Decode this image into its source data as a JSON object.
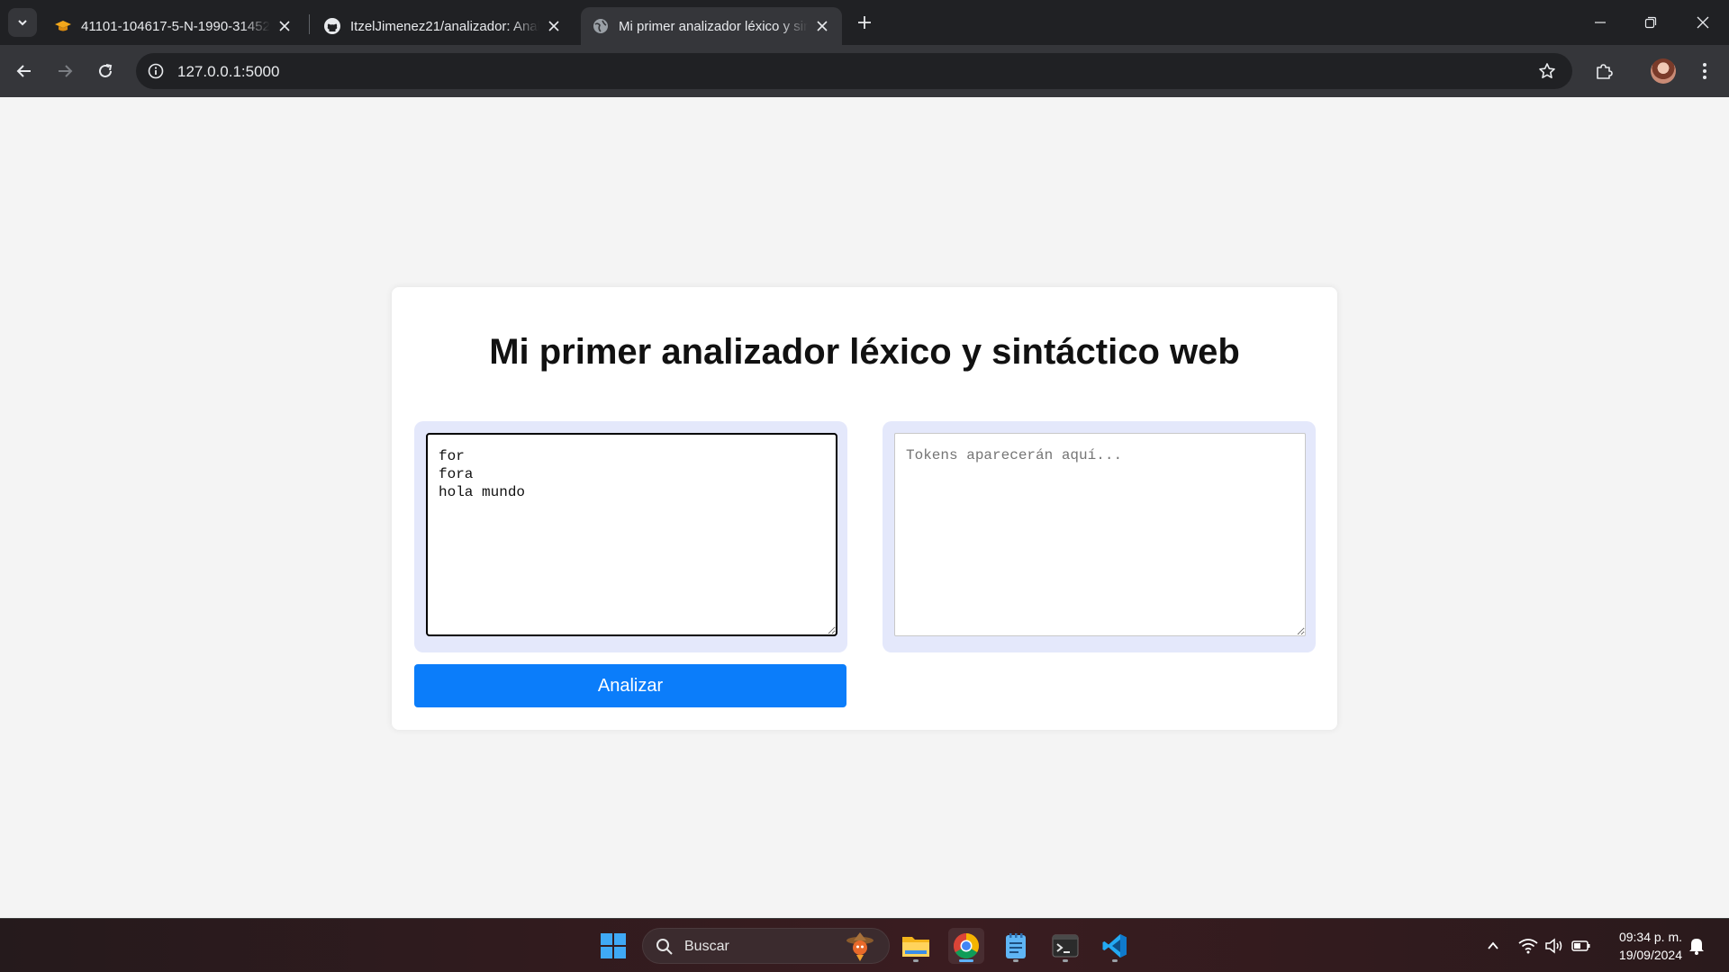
{
  "browser": {
    "tabs": [
      {
        "title": "41101-104617-5-N-1990-31452",
        "icon": "graduation-cap-icon",
        "active": false
      },
      {
        "title": "ItzelJimenez21/analizador: Anal",
        "icon": "github-icon",
        "active": false
      },
      {
        "title": "Mi primer analizador léxico y sin",
        "icon": "globe-icon",
        "active": true
      }
    ],
    "url": "127.0.0.1:5000"
  },
  "page": {
    "heading": "Mi primer analizador léxico y sintáctico web",
    "input": {
      "value": "for\nfora\nhola mundo"
    },
    "output": {
      "placeholder": "Tokens aparecerán aquí...",
      "value": ""
    },
    "button_label": "Analizar"
  },
  "taskbar": {
    "search_placeholder": "Buscar",
    "apps": [
      "start-icon",
      "file-explorer-icon",
      "chrome-icon",
      "notepad-icon",
      "terminal-icon",
      "vscode-icon"
    ],
    "clock_time": "09:34 p. m.",
    "clock_date": "19/09/2024"
  },
  "colors": {
    "accent_button": "#0b7dfa",
    "pane_background": "#e4e8fb",
    "page_background": "#f4f4f4"
  }
}
